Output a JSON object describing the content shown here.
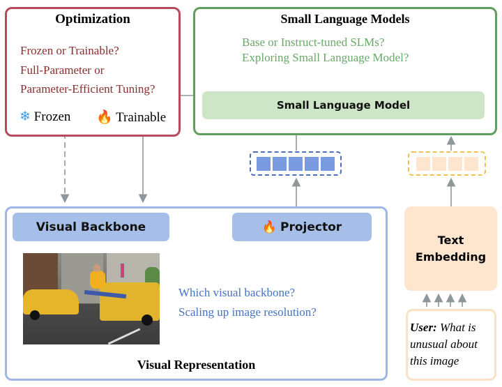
{
  "optimization": {
    "title": "Optimization",
    "questions": [
      "Frozen or Trainable?",
      "Full-Parameter or",
      "Parameter-Efficient Tuning?"
    ],
    "frozen_label": "Frozen",
    "trainable_label": "Trainable",
    "frozen_icon": "snowflake-icon",
    "trainable_icon": "fire-icon",
    "border_color": "#b84a5e",
    "text_color": "#8b2e2e"
  },
  "slm": {
    "title": "Small Language Models",
    "questions": [
      "Base or Instruct-tuned SLMs?",
      "Exploring Small Language Model?"
    ],
    "model_label": "Small Language Model",
    "border_color": "#5e9e5e",
    "text_color": "#6aa86a",
    "fill": "#cde6c8"
  },
  "visual": {
    "title": "Visual Representation",
    "backbone_label": "Visual Backbone",
    "projector_label": "Projector",
    "questions": [
      "Which visual backbone?",
      "Scaling up image resolution?"
    ],
    "border_color": "#9fb6e8",
    "fill": "#a6bfe9",
    "text_color": "#4472c4"
  },
  "text_embedding": {
    "label_line1": "Text",
    "label_line2": "Embedding",
    "fill": "#fde6cd"
  },
  "user_prompt": {
    "speaker": "User:",
    "text_line1": " What is",
    "text_line2": "unusual about",
    "text_line3": "this image"
  }
}
